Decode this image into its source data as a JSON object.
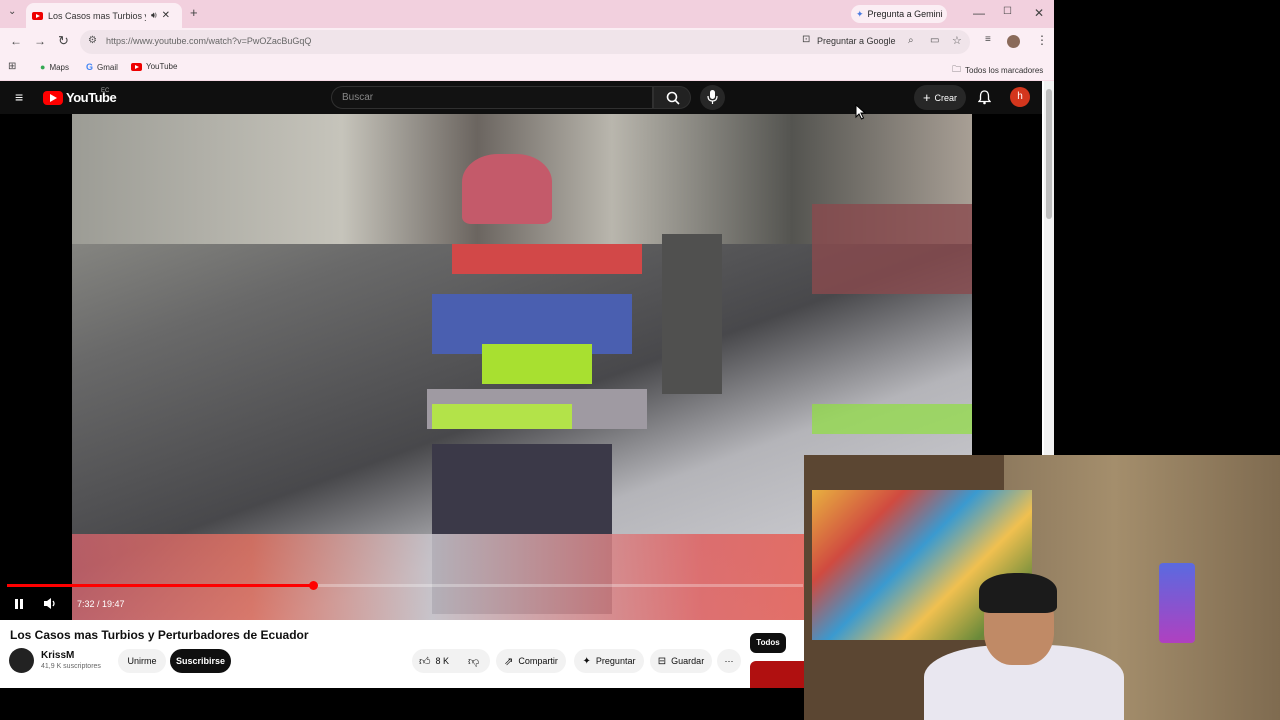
{
  "browser": {
    "tab_title": "Los Casos mas Turbios y Pe",
    "gemini_label": "Pregunta a Gemini",
    "url": "https://www.youtube.com/watch?v=PwOZacBuGqQ",
    "ask_google_label": "Preguntar a Google",
    "bookmarks": [
      "Maps",
      "Gmail",
      "YouTube"
    ],
    "all_bookmarks_label": "Todos los marcadores"
  },
  "youtube": {
    "logo_text": "YouTube",
    "region": "EC",
    "search_placeholder": "Buscar",
    "create_label": "Crear",
    "avatar_letter": "h",
    "player": {
      "time": "7:32 / 19:47",
      "progress": 0.385
    },
    "video": {
      "title": "Los Casos mas Turbios y Perturbadores de Ecuador",
      "channel_name": "KrissM",
      "subscribers": "41,9 K suscriptores",
      "join_label": "Unirme",
      "subscribe_label": "Suscribirse",
      "likes": "8 K",
      "share_label": "Compartir",
      "ask_label": "Preguntar",
      "save_label": "Guardar"
    },
    "chips": [
      "Todos"
    ]
  },
  "colors": {
    "accent": "#ff0000",
    "chrome_bg": "#f7dbe6",
    "masthead_bg": "#0f0f0f"
  }
}
